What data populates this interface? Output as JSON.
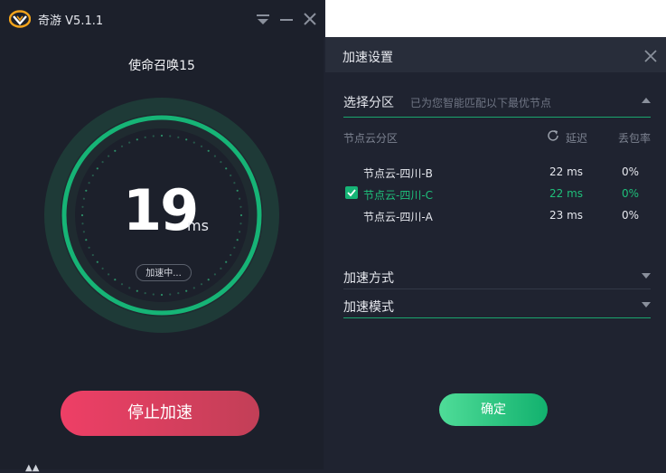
{
  "app": {
    "name": "奇游",
    "version": "V5.1.1"
  },
  "window_controls": [
    "menu-icon",
    "minimize-icon",
    "close-icon"
  ],
  "game": {
    "name": "使命召唤15"
  },
  "status": {
    "ping": "19",
    "unit": "ms",
    "label": "加速中..."
  },
  "stop_button": {
    "label": "停止加速"
  },
  "settings": {
    "title": "加速设置",
    "region": {
      "label": "选择分区",
      "hint": "已为您智能匹配以下最优节点"
    },
    "table": {
      "col_name": "节点云分区",
      "col_latency": "延迟",
      "col_loss": "丢包率"
    },
    "nodes": [
      {
        "name": "节点云-四川-B",
        "latency": "22 ms",
        "loss": "0%",
        "selected": false
      },
      {
        "name": "节点云-四川-C",
        "latency": "22 ms",
        "loss": "0%",
        "selected": true
      },
      {
        "name": "节点云-四川-A",
        "latency": "23 ms",
        "loss": "0%",
        "selected": false
      }
    ],
    "method": {
      "label": "加速方式"
    },
    "mode": {
      "label": "加速模式"
    },
    "confirm": {
      "label": "确定"
    }
  },
  "colors": {
    "accent": "#12b16e",
    "danger": "#ee3f66",
    "panel_bg": "#1c202b"
  }
}
